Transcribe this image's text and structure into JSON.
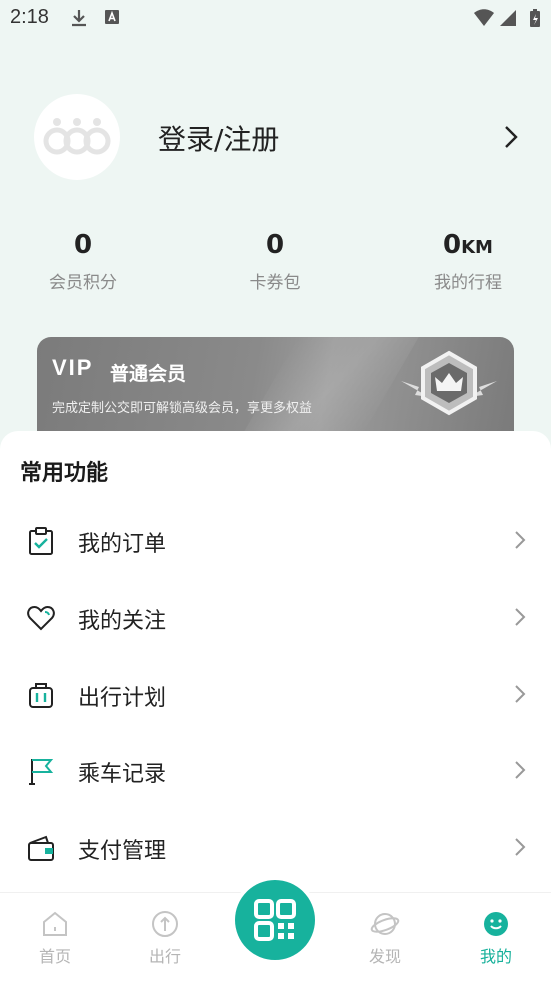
{
  "status_bar": {
    "time": "2:18"
  },
  "profile": {
    "login_label": "登录/注册"
  },
  "stats": [
    {
      "value": "0",
      "unit": "",
      "label": "会员积分"
    },
    {
      "value": "0",
      "unit": "",
      "label": "卡券包"
    },
    {
      "value": "0",
      "unit": "KM",
      "label": "我的行程"
    }
  ],
  "vip": {
    "tag": "VIP",
    "level": "普通会员",
    "description": "完成定制公交即可解锁高级会员，享更多权益"
  },
  "common_functions": {
    "title": "常用功能",
    "items": [
      {
        "label": "我的订单",
        "icon": "clipboard-check-icon"
      },
      {
        "label": "我的关注",
        "icon": "heart-icon"
      },
      {
        "label": "出行计划",
        "icon": "luggage-icon"
      },
      {
        "label": "乘车记录",
        "icon": "flag-icon"
      },
      {
        "label": "支付管理",
        "icon": "wallet-icon"
      }
    ]
  },
  "tab_bar": {
    "tabs": [
      {
        "label": "首页",
        "icon": "home-icon",
        "active": false
      },
      {
        "label": "出行",
        "icon": "compass-icon",
        "active": false
      },
      {
        "label": "发现",
        "icon": "planet-icon",
        "active": false
      },
      {
        "label": "我的",
        "icon": "smile-icon",
        "active": true
      }
    ],
    "scan_icon": "qr-code-icon"
  },
  "colors": {
    "accent": "#17b29d",
    "background": "#eef6f3",
    "vip_card": "#888888"
  }
}
